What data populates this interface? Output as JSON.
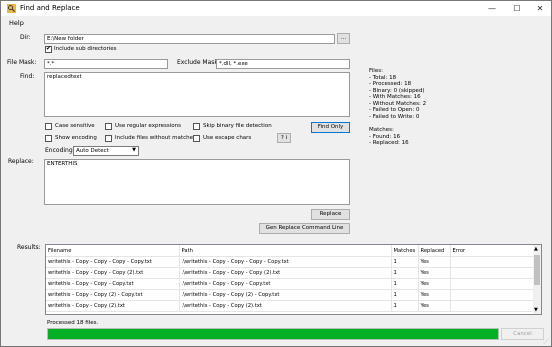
{
  "window": {
    "title": "Find and Replace"
  },
  "menu": {
    "help": "Help"
  },
  "labels": {
    "dir": "Dir:",
    "file_mask": "File Mask:",
    "exclude_mask": "Exclude Mask:",
    "find": "Find:",
    "encoding": "Encoding:",
    "replace": "Replace:",
    "results": "Results:"
  },
  "fields": {
    "dir": "E:\\New folder",
    "file_mask": "*.*",
    "exclude_mask": "*.dll, *.exe",
    "find": "replacedtext",
    "replace": "ENTERTHIS",
    "encoding": "Auto Detect"
  },
  "buttons": {
    "browse": "...",
    "find_only": "Find Only",
    "escape_help": "? i",
    "replace": "Replace",
    "gen_command": "Gen Replace Command Line",
    "cancel": "Cancel"
  },
  "options": {
    "include_sub": "Include sub directories",
    "case_sensitive": "Case sensitive",
    "use_regex": "Use regular expressions",
    "skip_binary": "Skip binary file detection",
    "show_encoding": "Show encoding",
    "include_without_matches": "Include files without matches",
    "use_escape": "Use escape chars"
  },
  "option_states": {
    "include_sub": true,
    "case_sensitive": false,
    "use_regex": false,
    "skip_binary": false,
    "show_encoding": false,
    "include_without_matches": false,
    "use_escape": false
  },
  "stats": {
    "header": "Files:",
    "total": "- Total: 18",
    "processed": "- Processed: 18",
    "binary": "- Binary: 0 (skipped)",
    "with_matches": "- With Matches: 16",
    "without_matches": "- Without Matches: 2",
    "failed_open": "- Failed to Open: 0",
    "failed_write": "- Failed to Write: 0",
    "matches_header": "Matches:",
    "found": "- Found: 16",
    "replaced": "- Replaced: 16"
  },
  "results": {
    "columns": [
      "Filename",
      "Path",
      "Matches",
      "Replaced",
      "Error"
    ],
    "rows": [
      [
        "writethis - Copy - Copy - Copy - Copy.txt",
        ".\\writethis - Copy - Copy - Copy - Copy.txt",
        "1",
        "Yes",
        ""
      ],
      [
        "writethis - Copy - Copy - Copy (2).txt",
        ".\\writethis - Copy - Copy - Copy (2).txt",
        "1",
        "Yes",
        ""
      ],
      [
        "writethis - Copy - Copy - Copy.txt",
        ".\\writethis - Copy - Copy - Copy.txt",
        "1",
        "Yes",
        ""
      ],
      [
        "writethis - Copy - Copy (2) - Copy.txt",
        ".\\writethis - Copy - Copy (2) - Copy.txt",
        "1",
        "Yes",
        ""
      ],
      [
        "writethis - Copy - Copy (2).txt",
        ".\\writethis - Copy - Copy (2).txt",
        "1",
        "Yes",
        ""
      ]
    ]
  },
  "status": {
    "text": "Processed 18 files.",
    "progress": 1.0
  },
  "colors": {
    "progress": "#06b025",
    "accent": "#0078d7"
  }
}
